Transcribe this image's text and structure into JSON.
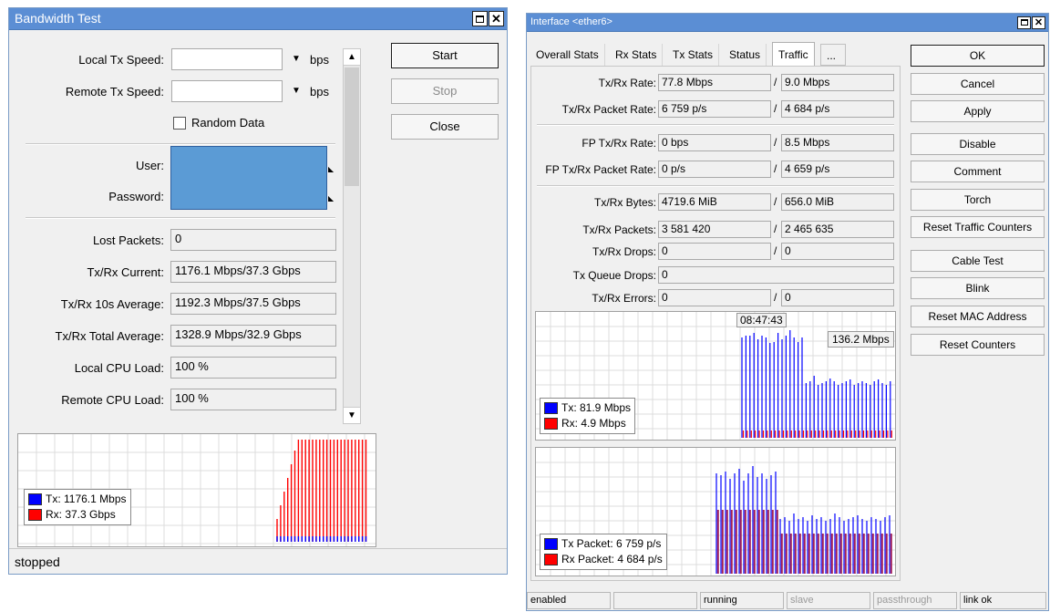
{
  "bandwidth_test": {
    "title": "Bandwidth Test",
    "local_tx_speed": {
      "label": "Local Tx Speed:",
      "value": "",
      "unit": "bps"
    },
    "remote_tx_speed": {
      "label": "Remote Tx Speed:",
      "value": "",
      "unit": "bps"
    },
    "random_data": {
      "label": "Random Data",
      "checked": false
    },
    "user": {
      "label": "User:",
      "value": ""
    },
    "password": {
      "label": "Password:",
      "value": ""
    },
    "lost_packets": {
      "label": "Lost Packets:",
      "value": "0"
    },
    "tx_rx_current": {
      "label": "Tx/Rx Current:",
      "value": "1176.1 Mbps/37.3 Gbps"
    },
    "tx_rx_10s_avg": {
      "label": "Tx/Rx 10s Average:",
      "value": "1192.3 Mbps/37.5 Gbps"
    },
    "tx_rx_total_avg": {
      "label": "Tx/Rx Total Average:",
      "value": "1328.9 Mbps/32.9 Gbps"
    },
    "local_cpu": {
      "label": "Local CPU Load:",
      "value": "100 %"
    },
    "remote_cpu": {
      "label": "Remote CPU Load:",
      "value": "100 %"
    },
    "buttons": {
      "start": "Start",
      "stop": "Stop",
      "close": "Close"
    },
    "legend": {
      "tx": "Tx:  1176.1 Mbps",
      "rx": "Rx:  37.3 Gbps"
    },
    "status": "stopped"
  },
  "interface": {
    "title": "Interface <ether6>",
    "tabs": [
      "Overall Stats",
      "Rx Stats",
      "Tx Stats",
      "Status",
      "Traffic",
      "..."
    ],
    "active_tab": "Traffic",
    "rows": {
      "rate": {
        "label": "Tx/Rx Rate:",
        "tx": "77.8 Mbps",
        "rx": "9.0 Mbps"
      },
      "packet_rate": {
        "label": "Tx/Rx Packet Rate:",
        "tx": "6 759 p/s",
        "rx": "4 684 p/s"
      },
      "fp_rate": {
        "label": "FP Tx/Rx Rate:",
        "tx": "0 bps",
        "rx": "8.5 Mbps"
      },
      "fp_packet_rate": {
        "label": "FP Tx/Rx Packet Rate:",
        "tx": "0 p/s",
        "rx": "4 659 p/s"
      },
      "bytes": {
        "label": "Tx/Rx Bytes:",
        "tx": "4719.6 MiB",
        "rx": "656.0 MiB"
      },
      "packets": {
        "label": "Tx/Rx Packets:",
        "tx": "3 581 420",
        "rx": "2 465 635"
      },
      "drops": {
        "label": "Tx/Rx Drops:",
        "tx": "0",
        "rx": "0"
      },
      "queue_drops": {
        "label": "Tx Queue Drops:",
        "value": "0"
      },
      "errors": {
        "label": "Tx/Rx Errors:",
        "tx": "0",
        "rx": "0"
      }
    },
    "slash": "/",
    "graph1": {
      "time": "08:47:43",
      "peak": "136.2 Mbps",
      "legend_tx": "Tx:  81.9 Mbps",
      "legend_rx": "Rx:  4.9 Mbps"
    },
    "graph2": {
      "legend_tx": "Tx Packet:  6 759 p/s",
      "legend_rx": "Rx Packet:  4 684 p/s"
    },
    "buttons": [
      "OK",
      "Cancel",
      "Apply",
      "Disable",
      "Comment",
      "Torch",
      "Reset Traffic Counters",
      "Cable Test",
      "Blink",
      "Reset MAC Address",
      "Reset Counters"
    ],
    "status": [
      "enabled",
      "",
      "running",
      "slave",
      "passthrough",
      "link ok"
    ]
  },
  "colors": {
    "tx": "#0000ff",
    "rx": "#ff0000",
    "title": "#5b8ed4",
    "user_field": "#5b9bd5"
  }
}
